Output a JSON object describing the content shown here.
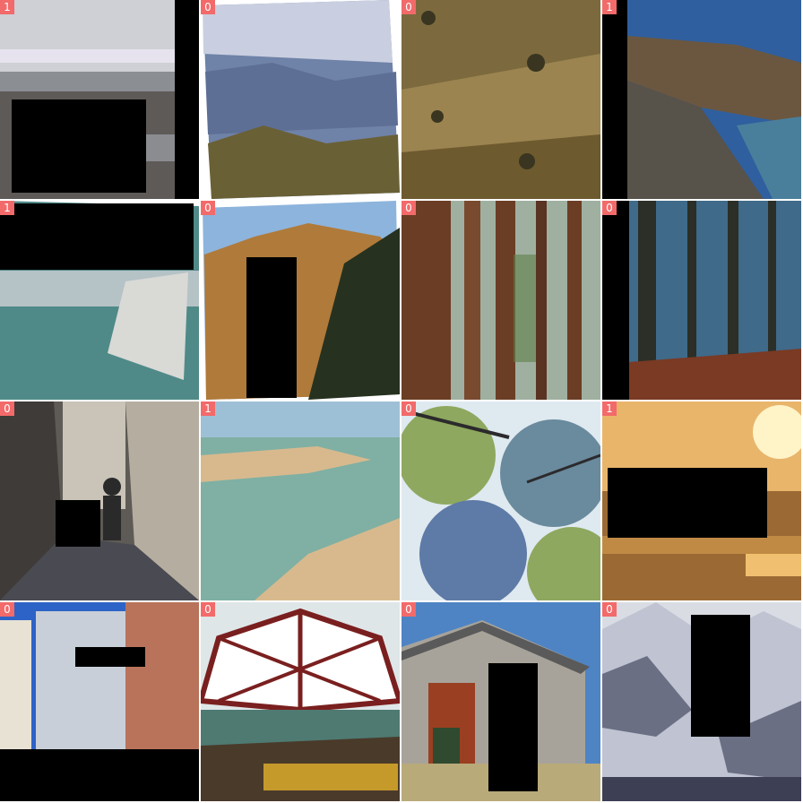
{
  "tiles": [
    {
      "id": "beach-pebbles",
      "label": "1",
      "colors": {
        "sky": "#cfcfd6",
        "sea": "#8b8e93",
        "ground": "#5d5a58"
      }
    },
    {
      "id": "mountain-valley",
      "label": "0",
      "colors": {
        "sky": "#c9cfe0",
        "far": "#6f82a8",
        "near": "#6a6036"
      }
    },
    {
      "id": "grassy-hillside",
      "label": "0",
      "colors": {
        "top": "#7c6a3e",
        "mid": "#9b8450",
        "low": "#6e5a2f"
      }
    },
    {
      "id": "coastal-cliffs",
      "label": "1",
      "colors": {
        "sea": "#2f5f9e",
        "rock": "#6b5740",
        "water": "#4a7f9c"
      }
    },
    {
      "id": "white-cliff-sea",
      "label": "1",
      "colors": {
        "sky": "#b5c2c6",
        "sea": "#4f8a88",
        "cliff": "#d9d9d6"
      }
    },
    {
      "id": "rocky-peak",
      "label": "0",
      "colors": {
        "sky": "#8db4dc",
        "rock": "#b07a3a",
        "trees": "#26321f"
      }
    },
    {
      "id": "redwood-forest",
      "label": "0",
      "colors": {
        "bg": "#9fb0a0",
        "trunk": "#6b3d25",
        "leaf": "#5f7f4a"
      }
    },
    {
      "id": "pine-forest",
      "label": "0",
      "colors": {
        "bg": "#3f6a8a",
        "trunk": "#2b2f27",
        "ground": "#7a3a24"
      }
    },
    {
      "id": "narrow-alley",
      "label": "0",
      "colors": {
        "wall": "#5e5a55",
        "light": "#c9c3b8",
        "ground": "#4a4a52"
      }
    },
    {
      "id": "shallow-lagoon",
      "label": "1",
      "colors": {
        "sky": "#9ec0d6",
        "sea": "#7fb0a3",
        "sand": "#d8b98e"
      }
    },
    {
      "id": "tree-canopy",
      "label": "0",
      "colors": {
        "sky": "#dfe9f0",
        "leaf": "#8ea85f",
        "branch": "#2b2a2c"
      }
    },
    {
      "id": "golden-sunset-beach",
      "label": "1",
      "colors": {
        "sky": "#e8b56b",
        "sun": "#fff3c8",
        "sea": "#9b6a34"
      }
    },
    {
      "id": "city-skyscrapers",
      "label": "0",
      "colors": {
        "sky": "#2d63c6",
        "tower": "#c8cfd8",
        "brick": "#b8735a"
      }
    },
    {
      "id": "market-dome",
      "label": "0",
      "colors": {
        "glass": "#dfe6e8",
        "frame": "#7a1f1f",
        "sign": "#c59a2a"
      }
    },
    {
      "id": "wooden-shed",
      "label": "0",
      "colors": {
        "sky": "#4e84c4",
        "wall": "#a7a39a",
        "door": "#9a3f22"
      }
    },
    {
      "id": "snowy-mountains",
      "label": "0",
      "colors": {
        "snow": "#d9dce3",
        "rock": "#6a6f84",
        "shadow": "#3d3f55"
      }
    }
  ]
}
